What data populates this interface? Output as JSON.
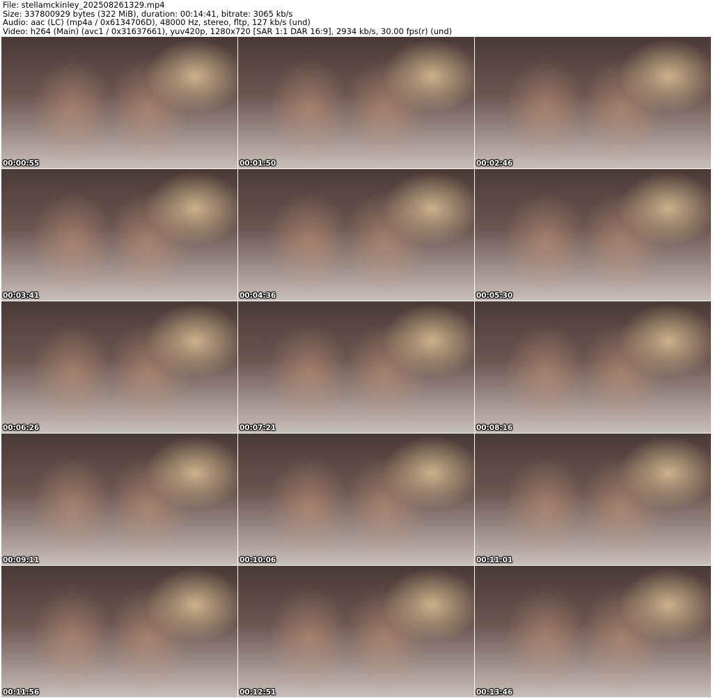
{
  "header": {
    "file": "File: stellamckinley_202508261329.mp4",
    "size": "Size: 337800929 bytes (322 MiB), duration: 00:14:41, bitrate: 3065 kb/s",
    "audio": "Audio: aac (LC) (mp4a / 0x6134706D), 48000 Hz, stereo, fltp, 127 kb/s (und)",
    "video": "Video: h264 (Main) (avc1 / 0x31637661), yuv420p, 1280x720 [SAR 1:1 DAR 16:9], 2934 kb/s, 30.00 fps(r) (und)"
  },
  "thumbnails": [
    {
      "timestamp": "00:00:55"
    },
    {
      "timestamp": "00:01:50"
    },
    {
      "timestamp": "00:02:46"
    },
    {
      "timestamp": "00:03:41"
    },
    {
      "timestamp": "00:04:36"
    },
    {
      "timestamp": "00:05:30"
    },
    {
      "timestamp": "00:06:26"
    },
    {
      "timestamp": "00:07:21"
    },
    {
      "timestamp": "00:08:16"
    },
    {
      "timestamp": "00:09:11"
    },
    {
      "timestamp": "00:10:06"
    },
    {
      "timestamp": "00:11:01"
    },
    {
      "timestamp": "00:11:56"
    },
    {
      "timestamp": "00:12:51"
    },
    {
      "timestamp": "00:13:46"
    }
  ]
}
